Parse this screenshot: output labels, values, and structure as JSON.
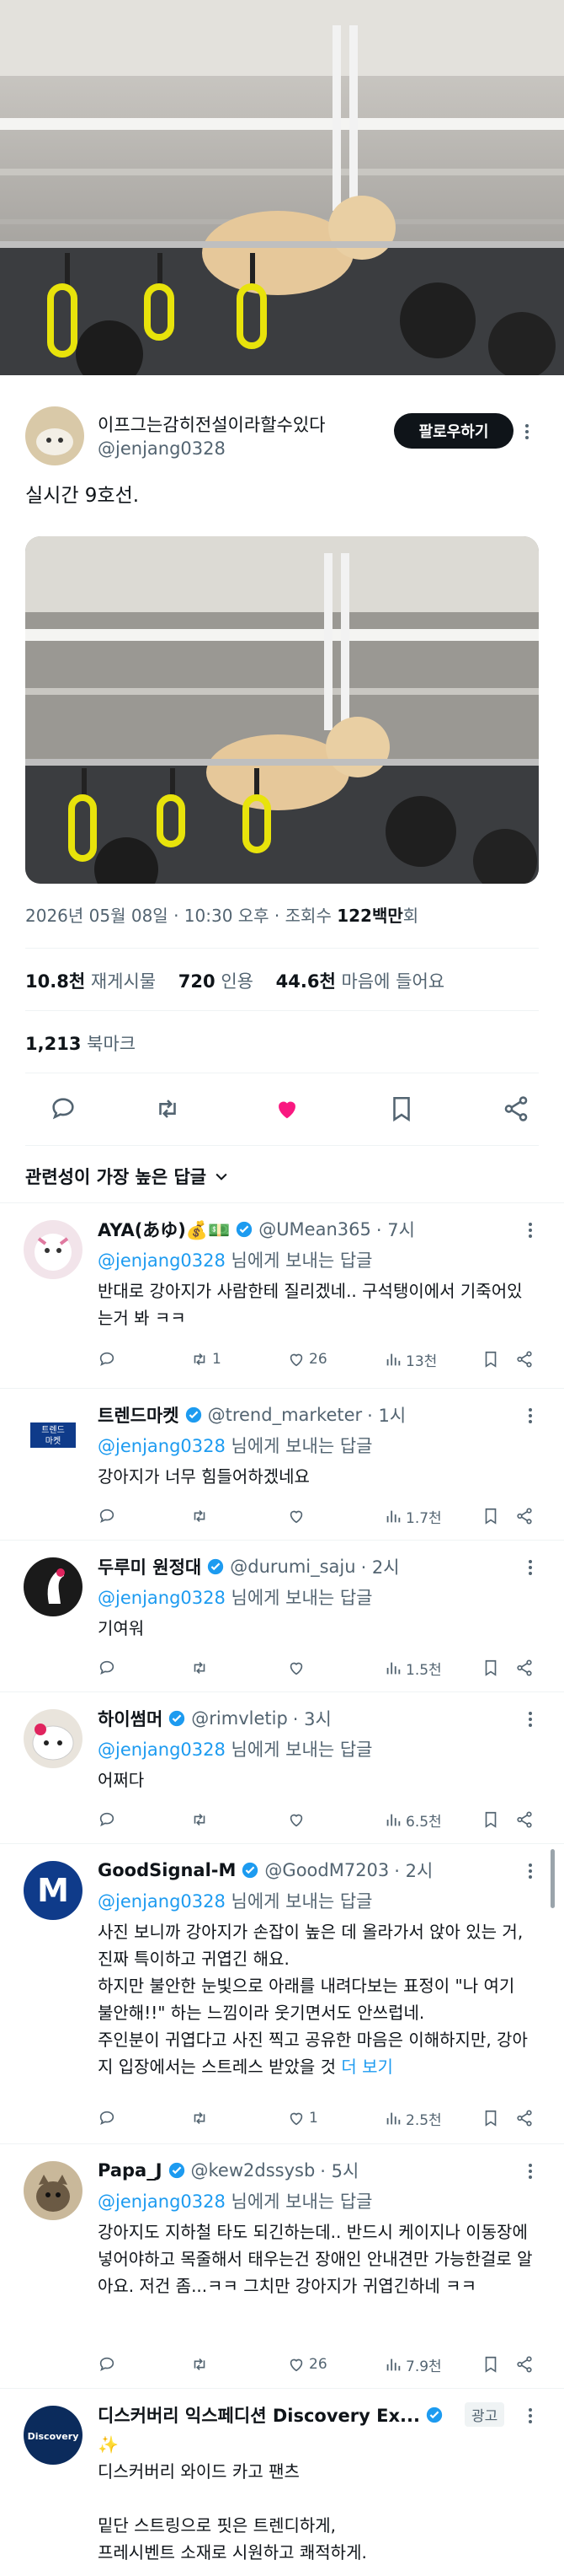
{
  "author": {
    "name": "이프그는감히전설이라할수있다",
    "handle": "@jenjang0328",
    "follow_label": "팔로우하기"
  },
  "tweet": {
    "text": "실시간 9호선.",
    "date": "2026년 05월 08일 · 10:30 오후 · 조회수 ",
    "views": "122백만",
    "views_suffix": "회"
  },
  "stats": {
    "retweets": "10.8천",
    "retweets_label": "재게시물",
    "quotes": "720",
    "quotes_label": "인용",
    "likes": "44.6천",
    "likes_label": "마음에 들어요",
    "bookmarks": "1,213",
    "bookmarks_label": "북마크"
  },
  "sort_label": "관련성이 가장 높은 답글",
  "reply_prefix": "님에게 보내는 답글",
  "replies": [
    {
      "name": "AYA(あゆ)💰💵",
      "handle": "@UMean365",
      "time": "· 7시",
      "to": "@jenjang0328",
      "body": "반대로 강아지가 사람한테 질리겠네.. 구석탱이에서 기죽어있는거 봐 ㅋㅋ",
      "replies": "",
      "retweets": "1",
      "likes": "26",
      "views": "13천"
    },
    {
      "name": "트렌드마켓",
      "handle": "@trend_marketer",
      "time": "· 1시",
      "to": "@jenjang0328",
      "body": "강아지가 너무 힘들어하겠네요",
      "replies": "",
      "retweets": "",
      "likes": "",
      "views": "1.7천",
      "avatar_text": "트렌드 마켓"
    },
    {
      "name": "두루미 원정대",
      "handle": "@durumi_saju",
      "time": "· 2시",
      "to": "@jenjang0328",
      "body": "기여워",
      "replies": "",
      "retweets": "",
      "likes": "",
      "views": "1.5천"
    },
    {
      "name": "하이썸머",
      "handle": "@rimvletip",
      "time": "· 3시",
      "to": "@jenjang0328",
      "body": "어쩌다",
      "replies": "",
      "retweets": "",
      "likes": "",
      "views": "6.5천"
    },
    {
      "name": "GoodSignal-M",
      "handle": "@GoodM7203",
      "time": "· 2시",
      "to": "@jenjang0328",
      "body": "사진 보니까 강아지가 손잡이 높은 데 올라가서 앉아 있는 거, 진짜 특이하고 귀엽긴 해요.\n하지만 불안한 눈빛으로 아래를 내려다보는 표정이 \"나 여기 불안해!!\" 하는 느낌이라 웃기면서도 안쓰럽네.\n주인분이 귀엽다고 사진 찍고 공유한 마음은 이해하지만, 강아지 입장에서는 스트레스 받았을 것 ",
      "more": "더 보기",
      "replies": "",
      "retweets": "",
      "likes": "1",
      "views": "2.5천"
    },
    {
      "name": "Papa_J",
      "handle": "@kew2dssysb",
      "time": "· 5시",
      "to": "@jenjang0328",
      "body": "강아지도 지하철 타도 되긴하는데.. 반드시 케이지나 이동장에 넣어야하고 목줄해서 태우는건 장애인 안내견만 가능한걸로 알아요. 저건 좀...ㅋㅋ 그치만 강아지가 귀엽긴하네 ㅋㅋ",
      "replies": "",
      "retweets": "",
      "likes": "26",
      "views": "7.9천"
    }
  ],
  "ad": {
    "name": "디스커버리 익스페디션 Discovery Ex...",
    "badge": "광고",
    "sparkle": "✨",
    "line1": "디스커버리 와이드 카고 팬츠",
    "line2": "밑단 스트링으로 핏은 트렌디하게,",
    "line3": "프레시벤트 소재로 시원하고 쾌적하게.",
    "avatar_text": "Discovery"
  },
  "colors": {
    "accent": "#1d9bf0",
    "like": "#f91880",
    "text": "#0f1419",
    "muted": "#536471"
  }
}
